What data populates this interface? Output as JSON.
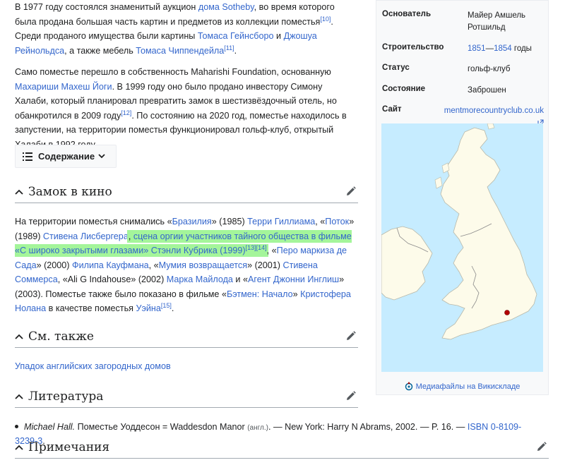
{
  "article": {
    "para1": {
      "t1": "В 1977 году состоялся знаменитый аукцион ",
      "l1": "дома Sotheby",
      "t2": ", во время которого была продана большая часть картин и предметов из коллекции поместья",
      "r1": "[10]",
      "t3": ". Среди проданого имущества были картины ",
      "l2": "Томаса Гейнсборо",
      "t4": " и ",
      "l3": "Джошуа Рейнольдса",
      "t5": ", а также мебель ",
      "l4": "Томаса Чиппендейла",
      "r2": "[11]",
      "t6": "."
    },
    "para2": {
      "t1": "Само поместье перешло в собственность Maharishi Foundation, основанную ",
      "l1": "Махариши Махеш Йоги",
      "t2": ". В 1999 году оно было продано инвестору Симону Халаби, который планировал превратить замок в шестизвёздочный отель, но обанкротился в 2009 году",
      "r1": "[12]",
      "t3": ". По состоянию на 2020 год, поместье находилось в запустении, на территории поместья функционировал гольф-клуб, открытый Халаби в 1992 году."
    },
    "toc_label": "Содержание",
    "sec_film": {
      "title": "Замок в кино",
      "t1": "На территории поместья снимались «",
      "l1": "Бразилия",
      "t2": "» (1985) ",
      "l2": "Терри Гиллиама",
      "t3": ", «",
      "l3": "Поток",
      "t4": "» (1989) ",
      "l4": "Стивена Лисбергера",
      "t5": ", ",
      "l5": "сцена оргии участников тайного общества в фильме «С широко закрытыми глазами» Стэнли Кубрика (1999)",
      "r1": "[13]",
      "r2": "[14]",
      "t6": ", «",
      "l6": "Перо маркиза де Сада",
      "t7": "» (2000) ",
      "l7": "Филипа Кауфмана",
      "t8": ", «",
      "l8": "Мумия возвращается",
      "t9": "» (2001) ",
      "l9": "Стивена Соммерса",
      "t10": ", «Ali G Indahouse» (2002) ",
      "l10": "Марка Майлода",
      "t11": " и «",
      "l11": "Агент Джонни Инглиш",
      "t12": "» (2003). Поместье также было показано в фильме «",
      "l12": "Бэтмен: Начало",
      "t13": "» ",
      "l13": "Кристофера Нолана",
      "t14": " в качестве поместья ",
      "l14": "Уэйна",
      "r3": "[15]",
      "t15": "."
    },
    "sec_see": {
      "title": "См. также",
      "link": "Упадок английских загородных домов"
    },
    "sec_lit": {
      "title": "Литература",
      "author": "Michael Hall.",
      "t1": " Поместье Уоддесон = Waddesdon Manor ",
      "lang": "(англ.)",
      "t2": ". — New York: Harry N Abrams, 2002. — P. 16. — ",
      "isbn": "ISBN 0-8109-3239-3",
      "t3": "."
    },
    "sec_notes": {
      "title": "Примечания"
    }
  },
  "infobox": {
    "founder_label": "Основатель",
    "founder_value": "Майер Амшель Ротшильд",
    "built_label": "Строительство",
    "built_y1": "1851",
    "built_dash": "—",
    "built_y2": "1854",
    "built_suffix": " годы",
    "status_label": "Статус",
    "status_value": "гольф-клуб",
    "state_label": "Состояние",
    "state_value": "Заброшен",
    "site_label": "Сайт",
    "site_value": "mentmorecountryclub.co.uk",
    "commons": "Медиафайлы на Викискладе"
  },
  "colors": {
    "link": "#3366cc",
    "highlight": "#a4f59a",
    "sea": "#c6ecff",
    "land": "#fdfbea",
    "marker": "#b30000"
  }
}
